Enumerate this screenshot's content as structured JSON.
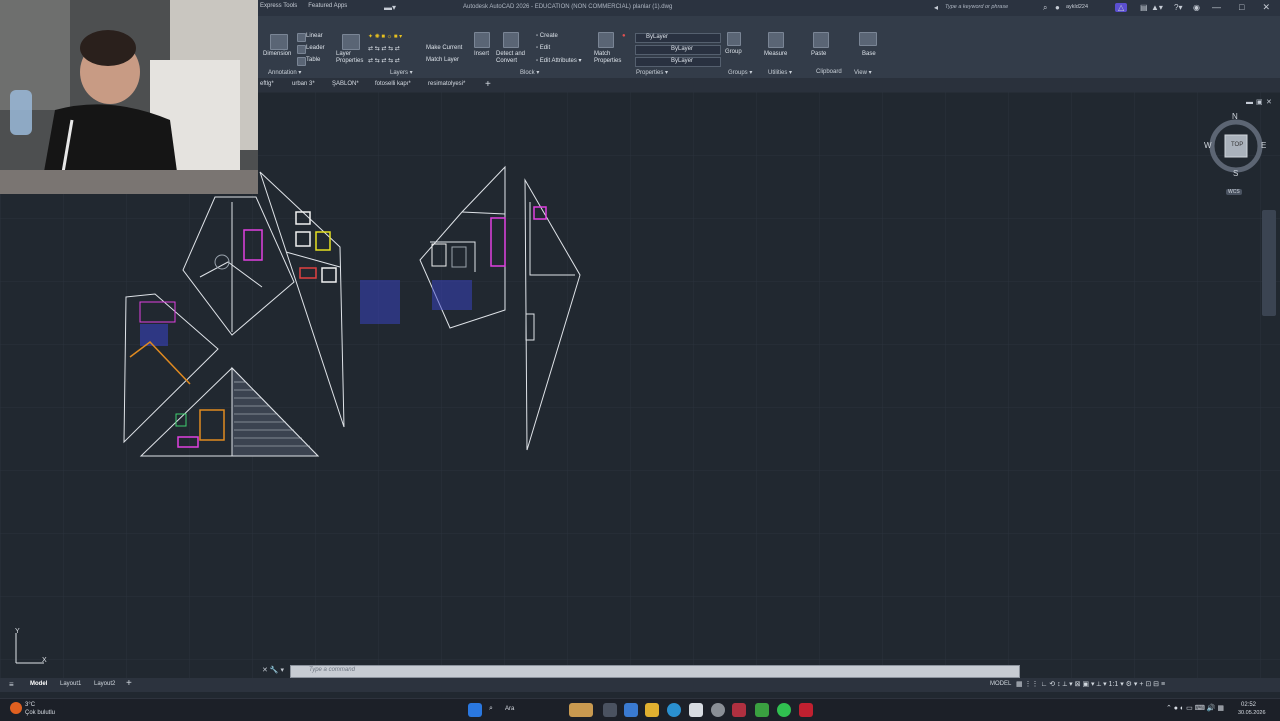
{
  "titlebar": {
    "tabs": [
      "Express Tools",
      "Featured Apps"
    ],
    "app_title": "Autodesk AutoCAD 2026 - EDUCATION (NON COMMERCIAL)   planlar (1).dwg",
    "search_placeholder": "Type a keyword or phrase",
    "user": "aykld224",
    "controls": [
      "—",
      "□",
      "✕"
    ]
  },
  "ribbon": {
    "dimension": "Dimension",
    "linear": "Linear",
    "leader": "Leader",
    "table": "Table",
    "layer_properties": "Layer Properties",
    "make_current": "Make Current",
    "match_layer": "Match Layer",
    "insert": "Insert",
    "detect_and_convert": "Detect and Convert",
    "create": "Create",
    "edit": "Edit",
    "edit_attributes": "Edit Attributes",
    "match_properties": "Match Properties",
    "bylayer_1": "ByLayer",
    "bylayer_2": "ByLayer",
    "bylayer_3": "ByLayer",
    "group": "Group",
    "measure": "Measure",
    "paste": "Paste",
    "base": "Base",
    "panels": {
      "annotation": "Annotation ▾",
      "layers": "Layers ▾",
      "block": "Block ▾",
      "properties": "Properties ▾",
      "groups": "Groups ▾",
      "utilities": "Utilities ▾",
      "clipboard": "Clipboard",
      "view": "View ▾"
    }
  },
  "file_tabs": [
    "eftlg*",
    "urban 3*",
    "ŞABLON*",
    "fotoselli kapı*",
    "resimatolyesi*"
  ],
  "add_tab": "+",
  "navcube": {
    "top": "TOP",
    "n": "N",
    "s": "S",
    "e": "E",
    "w": "W",
    "wcs": "WCS"
  },
  "command_placeholder": "Type a command",
  "status_tabs": {
    "model": "Model",
    "layout1": "Layout1",
    "layout2": "Layout2",
    "add": "+"
  },
  "model_space": "MODEL",
  "taskbar": {
    "weather_temp": "3°C",
    "weather_desc": "Çok bulutlu",
    "search": "Ara",
    "time": "02:52",
    "date": "30.05.2026"
  },
  "colors": {
    "canvas": "#212830",
    "linework": "#dfe3e8",
    "magenta": "#e040e0",
    "blue": "#3a44c8",
    "orange": "#e08a20",
    "red": "#e04040",
    "yellow": "#e6e020",
    "green": "#40d070"
  }
}
